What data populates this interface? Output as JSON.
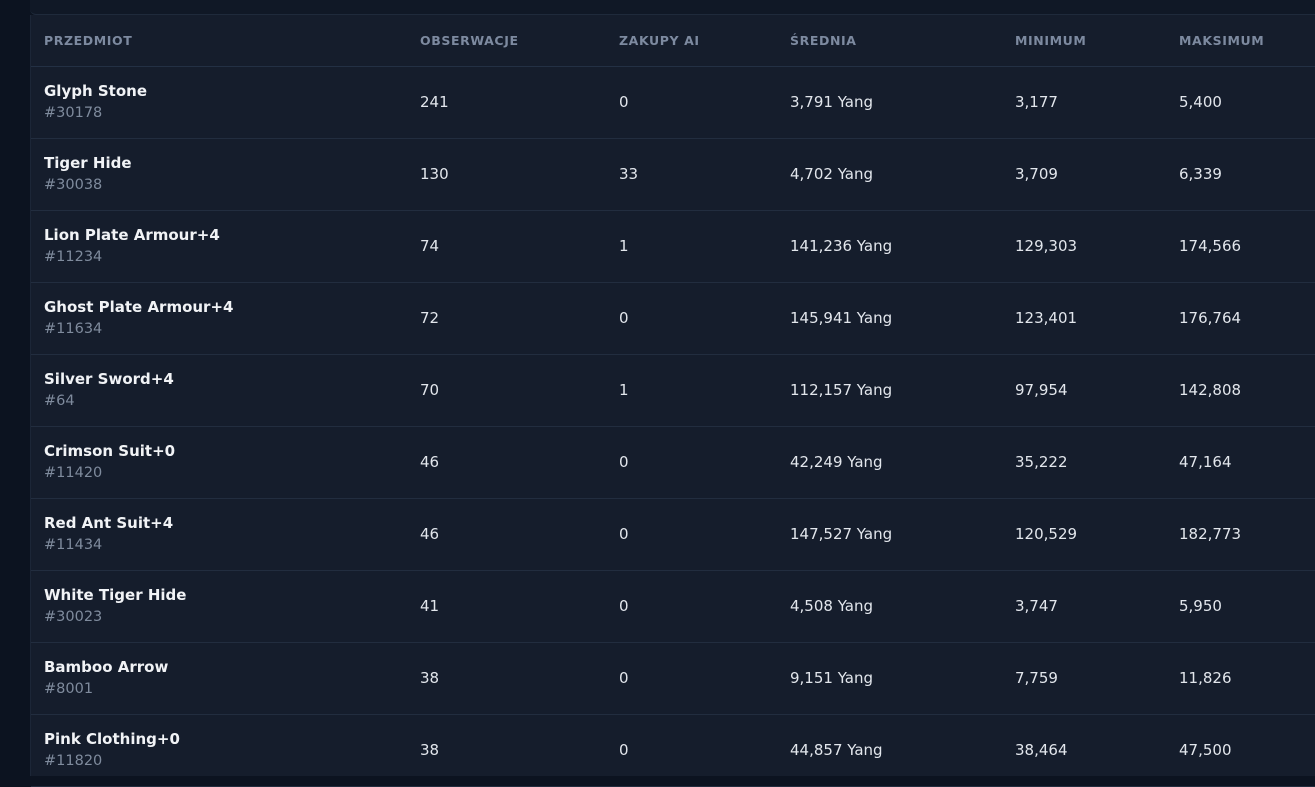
{
  "table": {
    "headers": {
      "item": "PRZEDMIOT",
      "observations": "OBSERWACJE",
      "ai_purchases": "ZAKUPY AI",
      "average": "ŚREDNIA",
      "minimum": "MINIMUM",
      "maximum": "MAKSIMUM"
    },
    "rows": [
      {
        "name": "Glyph Stone",
        "id": "#30178",
        "observations": "241",
        "ai_purchases": "0",
        "average": "3,791 Yang",
        "minimum": "3,177",
        "maximum": "5,400"
      },
      {
        "name": "Tiger Hide",
        "id": "#30038",
        "observations": "130",
        "ai_purchases": "33",
        "average": "4,702 Yang",
        "minimum": "3,709",
        "maximum": "6,339"
      },
      {
        "name": "Lion Plate Armour+4",
        "id": "#11234",
        "observations": "74",
        "ai_purchases": "1",
        "average": "141,236 Yang",
        "minimum": "129,303",
        "maximum": "174,566"
      },
      {
        "name": "Ghost Plate Armour+4",
        "id": "#11634",
        "observations": "72",
        "ai_purchases": "0",
        "average": "145,941 Yang",
        "minimum": "123,401",
        "maximum": "176,764"
      },
      {
        "name": "Silver Sword+4",
        "id": "#64",
        "observations": "70",
        "ai_purchases": "1",
        "average": "112,157 Yang",
        "minimum": "97,954",
        "maximum": "142,808"
      },
      {
        "name": "Crimson Suit+0",
        "id": "#11420",
        "observations": "46",
        "ai_purchases": "0",
        "average": "42,249 Yang",
        "minimum": "35,222",
        "maximum": "47,164"
      },
      {
        "name": "Red Ant Suit+4",
        "id": "#11434",
        "observations": "46",
        "ai_purchases": "0",
        "average": "147,527 Yang",
        "minimum": "120,529",
        "maximum": "182,773"
      },
      {
        "name": "White Tiger Hide",
        "id": "#30023",
        "observations": "41",
        "ai_purchases": "0",
        "average": "4,508 Yang",
        "minimum": "3,747",
        "maximum": "5,950"
      },
      {
        "name": "Bamboo Arrow",
        "id": "#8001",
        "observations": "38",
        "ai_purchases": "0",
        "average": "9,151 Yang",
        "minimum": "7,759",
        "maximum": "11,826"
      },
      {
        "name": "Pink Clothing+0",
        "id": "#11820",
        "observations": "38",
        "ai_purchases": "0",
        "average": "44,857 Yang",
        "minimum": "38,464",
        "maximum": "47,500"
      }
    ]
  }
}
